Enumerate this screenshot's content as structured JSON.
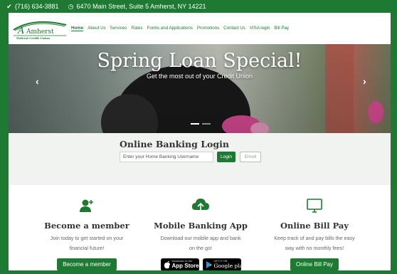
{
  "topbar": {
    "phone": "(716) 634-3881",
    "address": "6470 Main Street, Suite 5 Amherst, NY 14221"
  },
  "brand": {
    "name": "Amherst",
    "subtitle": "Federal Credit Union",
    "color": "#1e7a33"
  },
  "nav": {
    "items": [
      {
        "label": "Home",
        "active": true
      },
      {
        "label": "About Us"
      },
      {
        "label": "Services"
      },
      {
        "label": "Rates"
      },
      {
        "label": "Forms and Applications"
      },
      {
        "label": "Promotions"
      },
      {
        "label": "Contact Us"
      },
      {
        "label": "VISA login"
      },
      {
        "label": "Bill Pay"
      }
    ]
  },
  "hero": {
    "title": "Spring Loan Special!",
    "subtitle": "Get the most out of your Credit Union",
    "prev_icon": "chevron-left-icon",
    "next_icon": "chevron-right-icon"
  },
  "login": {
    "title": "Online Banking Login",
    "placeholder": "Enter your Home Banking Username",
    "login_label": "Login",
    "enroll_label": "Enroll"
  },
  "features": [
    {
      "icon": "add-user-icon",
      "title": "Become a member",
      "line1": "Join today to get started on your",
      "line2": "financial future!",
      "cta": "Become a member"
    },
    {
      "icon": "cloud-upload-icon",
      "title": "Mobile Banking App",
      "line1": "Download our mobile app and bank",
      "line2": "on the go!",
      "appstore_small": "Download on the",
      "appstore_large": "App Store",
      "googleplay_small": "GET IT ON",
      "googleplay_large": "Google play"
    },
    {
      "icon": "monitor-icon",
      "title": "Online Bill Pay",
      "line1": "Keep track of and pay bills the easy",
      "line2": "way with no monthly fees!",
      "cta": "Online Bill Pay"
    }
  ]
}
